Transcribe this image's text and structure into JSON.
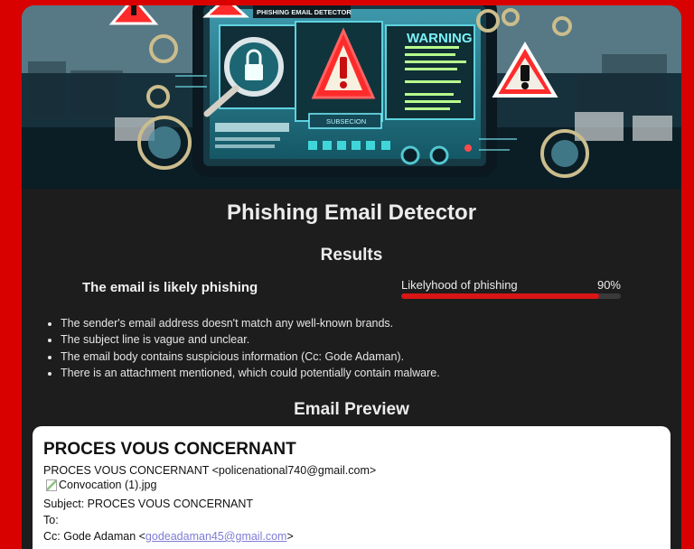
{
  "colors": {
    "page_background": "#d90000",
    "panel_background": "#1d1d1d",
    "meter_fill": "#d91515",
    "preview_background": "#ffffff",
    "link": "#7f7cd6"
  },
  "hero": {
    "alt": "Phishing Email Detector warning illustration",
    "screen_title": "PHISHING EMAIL DETECTOR",
    "screen_side": "WARNING",
    "button_text": "SUBSECION"
  },
  "app": {
    "title": "Phishing Email Detector"
  },
  "results": {
    "title": "Results",
    "verdict": "The email is likely phishing",
    "likelihood_label": "Likelyhood of phishing",
    "likelihood_text": "90%",
    "likelihood_fraction": 0.9,
    "reasons": [
      "The sender's email address doesn't match any well-known brands.",
      "The subject line is vague and unclear.",
      "The email body contains suspicious information (Cc: Gode Adaman).",
      "There is an attachment mentioned, which could potentially contain malware."
    ]
  },
  "preview": {
    "title": "Email Preview",
    "heading": "PROCES VOUS CONCERNANT",
    "from_line": "PROCES VOUS CONCERNANT <policenational740@gmail.com>",
    "attachment_name": "Convocation (1).jpg",
    "subject_line": "Subject: PROCES VOUS CONCERNANT",
    "to_line": "To:",
    "cc_prefix": "Cc: Gode Adaman <",
    "cc_email": "godeadaman45@gmail.com",
    "cc_suffix": ">"
  }
}
